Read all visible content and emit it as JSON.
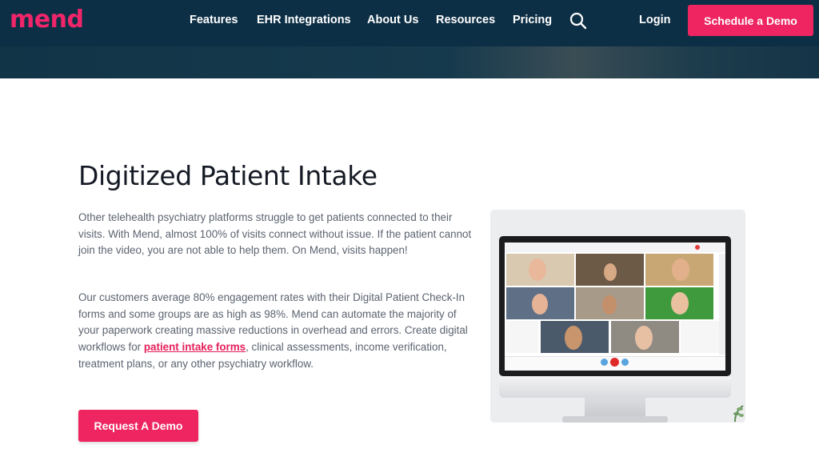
{
  "brand": {
    "logo": "mend",
    "accent": "#ee2560",
    "nav_bg": "#0d2f45"
  },
  "nav": {
    "links": [
      "Features",
      "EHR Integrations",
      "About Us",
      "Resources",
      "Pricing"
    ],
    "search_icon": "search-icon",
    "login": "Login",
    "cta": "Schedule a Demo"
  },
  "section": {
    "title": "Digitized Patient Intake",
    "para1": "Other telehealth psychiatry platforms struggle to get patients connected to their visits. With Mend, almost 100% of visits connect without issue. If the patient cannot join the video, you are not able to help them. On Mend, visits happen!",
    "para2_before": "Our customers average 80% engagement rates with their Digital Patient Check-In forms and some groups are as high as 98%. Mend can automate the majority of your paperwork creating massive reductions in overhead and errors. Create digital workflows for ",
    "para2_link": "patient intake forms",
    "para2_after": ", clinical assessments, income verification, treatment plans, or any other psychiatry workflow.",
    "cta": "Request A Demo"
  },
  "image": {
    "icon": "video-call-monitor-image"
  }
}
